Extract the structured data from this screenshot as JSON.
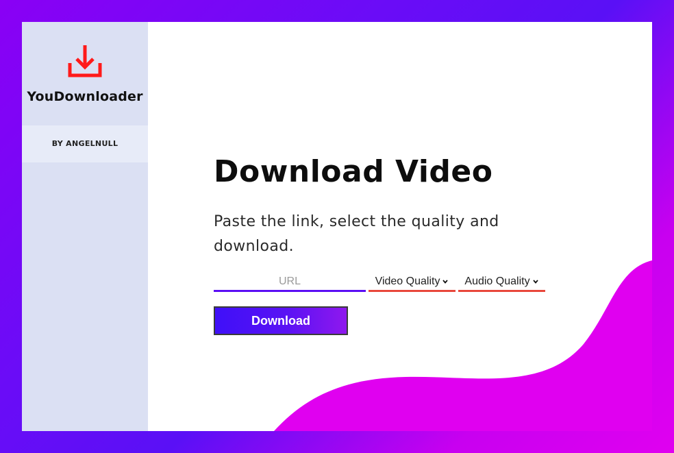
{
  "app": {
    "title": "YouDownloader",
    "byline": "BY ANGELNULL",
    "logo_icon": "download-icon"
  },
  "main": {
    "heading": "Download Video",
    "subtitle": "Paste the link, select the quality and download.",
    "url_input": {
      "placeholder": "URL",
      "value": ""
    },
    "video_quality": {
      "selected": "Video Quality",
      "icon": "chevron-down-icon"
    },
    "audio_quality": {
      "selected": "Audio Quality",
      "icon": "chevron-down-icon"
    },
    "download_button": "Download"
  },
  "colors": {
    "accent": "#5a0ef4",
    "logo_red": "#ff1a1a",
    "select_underline": "#e8473b",
    "wave": "#e000f0",
    "sidebar_bg": "#dbe0f3"
  }
}
